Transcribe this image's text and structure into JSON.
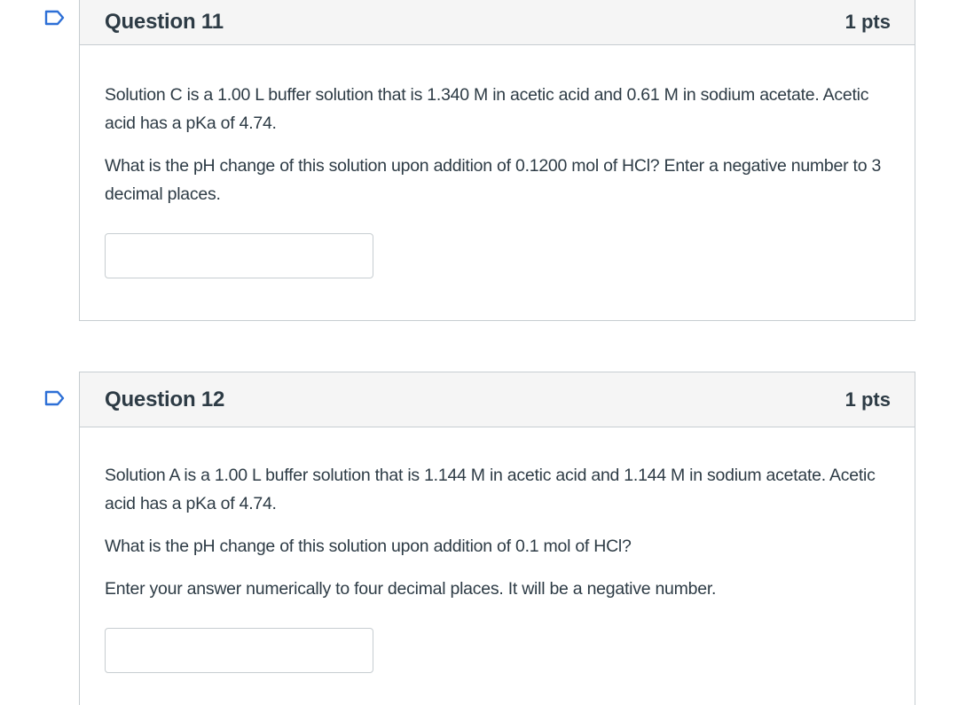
{
  "questions": [
    {
      "title": "Question 11",
      "points": "1 pts",
      "paragraphs": [
        "Solution C is a 1.00 L buffer solution that is 1.340 M in acetic acid and 0.61 M in sodium acetate. Acetic acid has a pKa of 4.74.",
        "What is the pH change of this solution upon addition of 0.1200 mol of HCl? Enter a negative number to 3 decimal places."
      ],
      "answer_value": ""
    },
    {
      "title": "Question 12",
      "points": "1 pts",
      "paragraphs": [
        "Solution A is a 1.00 L buffer solution that is 1.144 M in acetic acid and 1.144 M in sodium acetate. Acetic acid has a pKa of 4.74.",
        "What is the pH change of this solution upon addition of 0.1 mol of HCl?",
        "Enter your answer numerically to four decimal places.  It will be a negative number."
      ],
      "answer_value": ""
    }
  ],
  "colors": {
    "flag_stroke": "#2d6fd6",
    "header_bg": "#f5f5f5",
    "border": "#c7cdd1",
    "text": "#2d3b45"
  },
  "icons": {
    "flag": "bookmark-flag-icon"
  }
}
